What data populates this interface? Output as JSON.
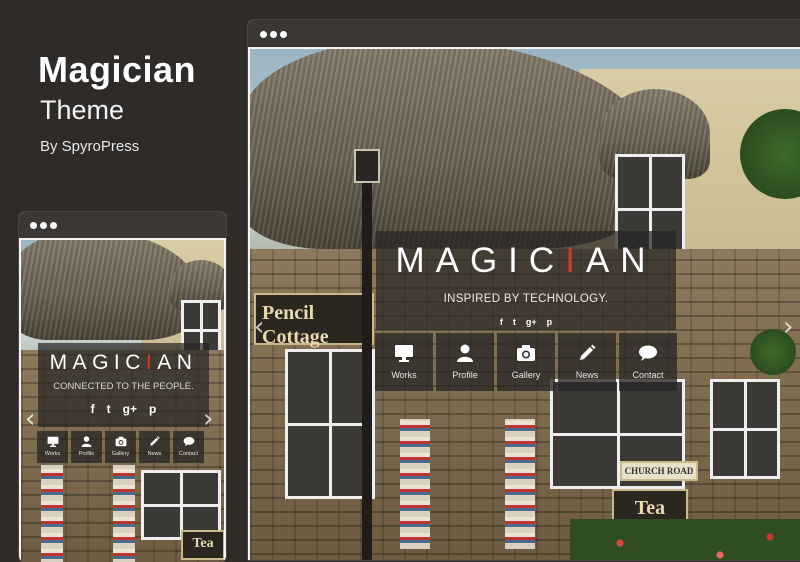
{
  "promo": {
    "title": "Magician",
    "subtitle": "Theme",
    "byline": "By SpyroPress"
  },
  "desktop_preview": {
    "brand_before": "MAGIC",
    "brand_accent": "I",
    "brand_after": "AN",
    "tagline": "INSPIRED BY TECHNOLOGY.",
    "social": [
      "f",
      "t",
      "g+",
      "p"
    ],
    "menu": [
      {
        "label": "Works",
        "icon": "monitor-icon"
      },
      {
        "label": "Profile",
        "icon": "user-icon"
      },
      {
        "label": "Gallery",
        "icon": "camera-icon"
      },
      {
        "label": "News",
        "icon": "pencil-icon"
      },
      {
        "label": "Contact",
        "icon": "chat-bubble-icon"
      }
    ],
    "sign_text": "Pencil Cottage",
    "sign_right": "CHURCH ROAD",
    "tea_sign": "Tea Gardens"
  },
  "mobile_preview": {
    "brand_before": "MAGIC",
    "brand_accent": "I",
    "brand_after": "AN",
    "tagline": "CONNECTED TO THE PEOPLE.",
    "social": [
      "f",
      "t",
      "g+",
      "p"
    ],
    "menu": [
      {
        "label": "Works",
        "icon": "monitor-icon"
      },
      {
        "label": "Profile",
        "icon": "user-icon"
      },
      {
        "label": "Gallery",
        "icon": "camera-icon"
      },
      {
        "label": "News",
        "icon": "pencil-icon"
      },
      {
        "label": "Contact",
        "icon": "chat-bubble-icon"
      }
    ],
    "tea_sign": "Tea"
  },
  "colors": {
    "background": "#2e2b29",
    "accent": "#d9362b",
    "overlay": "rgba(40,38,36,0.72)"
  }
}
